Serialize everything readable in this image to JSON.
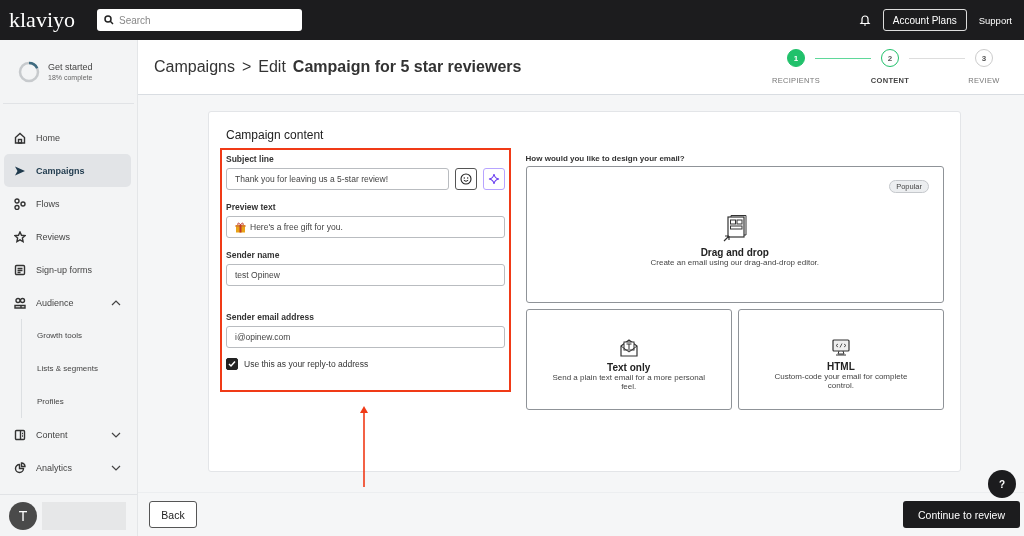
{
  "topbar": {
    "logo": "klaviyo",
    "search": {
      "placeholder": "Search"
    },
    "account_button": "Account Plans",
    "support_link": "Support"
  },
  "sidebar": {
    "get_started": {
      "title": "Get started",
      "subtitle": "18% complete",
      "level": 0.18
    },
    "items": [
      {
        "label": "Home",
        "selected": false
      },
      {
        "label": "Campaigns",
        "selected": true
      },
      {
        "label": "Flows",
        "selected": false
      },
      {
        "label": "Reviews",
        "selected": false
      },
      {
        "label": "Sign-up forms",
        "selected": false
      },
      {
        "label": "Audience",
        "selected": false,
        "expanded": true,
        "children": [
          {
            "label": "Growth tools",
            "selected": false
          },
          {
            "label": "Lists & segments",
            "selected": false
          },
          {
            "label": "Profiles",
            "selected": false
          }
        ]
      },
      {
        "label": "Content",
        "selected": false,
        "expanded": false
      },
      {
        "label": "Analytics",
        "selected": false,
        "expanded": false
      }
    ],
    "user": {
      "initial": "T"
    }
  },
  "header": {
    "breadcrumb": "Campaigns",
    "separator": ">",
    "edit_prefix": "Edit",
    "campaign_name": "Campaign for 5 star reviewers",
    "steps": [
      {
        "number": "1",
        "label": "RECIPIENTS",
        "completed": true,
        "selected": false
      },
      {
        "number": "2",
        "label": "CONTENT",
        "completed": false,
        "selected": true
      },
      {
        "number": "3",
        "label": "REVIEW",
        "completed": false,
        "selected": false
      }
    ]
  },
  "card": {
    "title": "Campaign content",
    "fields": [
      {
        "label": "Subject line",
        "value": "Thank you for leaving us a 5-star review!",
        "kind": "subject"
      },
      {
        "label": "Preview text",
        "value": "Here's a free gift for you.",
        "kind": "gift"
      },
      {
        "label": "Sender name",
        "value": "test Opinew",
        "kind": "plain"
      },
      {
        "label": "Sender email address",
        "value": "i@opinew.com",
        "kind": "plain"
      }
    ],
    "reply_to": {
      "label": "Use this as your reply-to address",
      "checked": true
    },
    "design_question": "How would you like to design your email?",
    "design_options": [
      {
        "kind": "dragdrop",
        "title": "Drag and drop",
        "description": "Create an email using our drag-and-drop editor.",
        "badge": "Popular"
      },
      {
        "kind": "text",
        "title": "Text only",
        "description": "Send a plain text email for a more personal feel."
      },
      {
        "kind": "html",
        "title": "HTML",
        "description": "Custom-code your email for complete control."
      }
    ]
  },
  "footer": {
    "back": "Back",
    "continue": "Continue to review",
    "help": "?"
  }
}
